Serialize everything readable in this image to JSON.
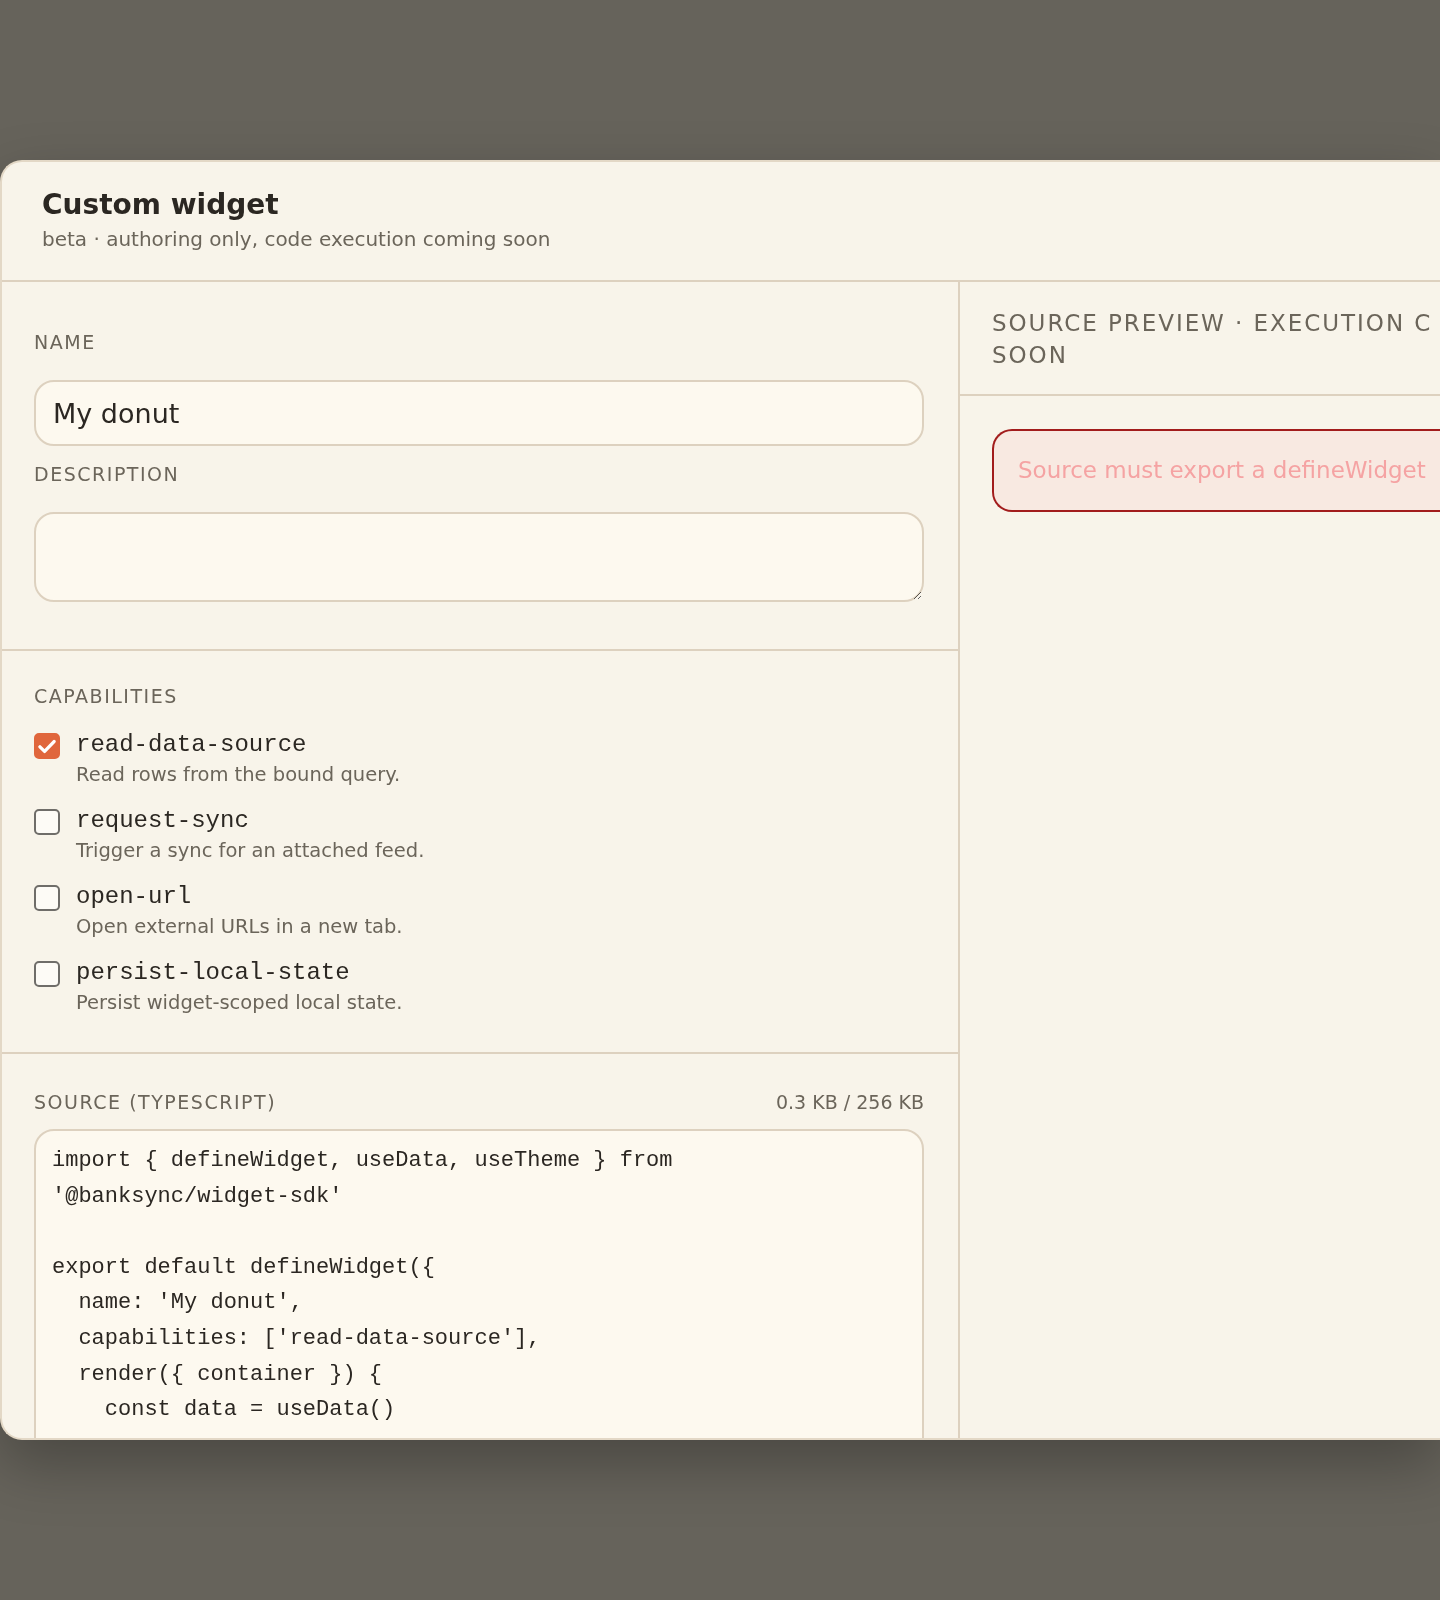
{
  "dialog": {
    "title": "Custom widget",
    "subtitle": "beta · authoring only, code execution coming soon"
  },
  "form": {
    "name": {
      "label": "NAME",
      "value": "My donut"
    },
    "description": {
      "label": "DESCRIPTION"
    }
  },
  "capabilities": {
    "label": "CAPABILITIES",
    "items": [
      {
        "name": "read-data-source",
        "description": "Read rows from the bound query.",
        "checked": true
      },
      {
        "name": "request-sync",
        "description": "Trigger a sync for an attached feed.",
        "checked": false
      },
      {
        "name": "open-url",
        "description": "Open external URLs in a new tab.",
        "checked": false
      },
      {
        "name": "persist-local-state",
        "description": "Persist widget-scoped local state.",
        "checked": false
      }
    ]
  },
  "source": {
    "label": "SOURCE (TYPESCRIPT)",
    "size": "0.3 KB / 256 KB",
    "code": "import { defineWidget, useData, useTheme } from '@banksync/widget-sdk'\n\nexport default defineWidget({\n  name: 'My donut',\n  capabilities: ['read-data-source'],\n  render({ container }) {\n    const data = useData()"
  },
  "preview": {
    "title_lines": [
      "SOURCE PREVIEW · EXECUTION C",
      "SOON"
    ],
    "error": "Source must export a defineWidget"
  }
}
